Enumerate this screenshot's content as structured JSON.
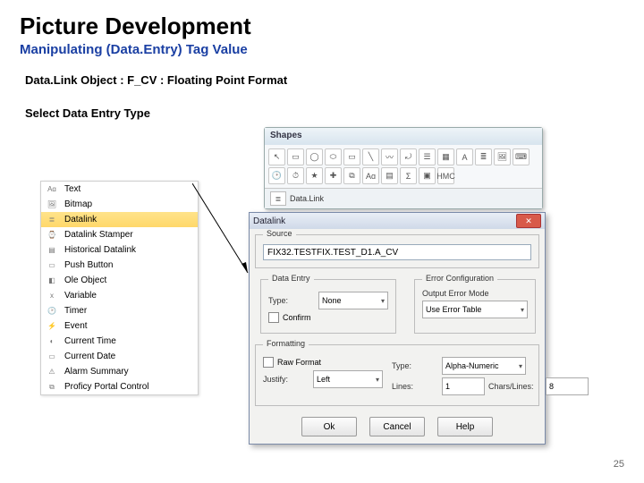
{
  "title": "Picture Development",
  "subtitle": "Manipulating (Data.Entry) Tag Value",
  "line_object": "Data.Link Object : F_CV : Floating Point Format",
  "line_select": "Select Data Entry Type",
  "pagenum": "25",
  "toolbox": {
    "header": "Shapes",
    "footer_label": "Data.Link",
    "tools": [
      "↖",
      "▭",
      "◯",
      "⬭",
      "▭",
      "╲",
      "〰",
      "⤾",
      "☰",
      "▦",
      "A",
      "≣",
      "🖼",
      "⌨",
      "🕑",
      "⏱",
      "★",
      "✚",
      "⧉",
      "Aɑ",
      "▤",
      "Σ",
      "▣",
      "HMC"
    ]
  },
  "menu": {
    "items": [
      {
        "icon": "Aɑ",
        "label": "Text"
      },
      {
        "icon": "🖼",
        "label": "Bitmap"
      },
      {
        "icon": "≣",
        "label": "Datalink",
        "selected": true
      },
      {
        "icon": "⌚",
        "label": "Datalink Stamper"
      },
      {
        "icon": "▤",
        "label": "Historical Datalink"
      },
      {
        "icon": "▭",
        "label": "Push Button"
      },
      {
        "icon": "◧",
        "label": "Ole Object"
      },
      {
        "icon": "x",
        "label": "Variable"
      },
      {
        "icon": "🕑",
        "label": "Timer"
      },
      {
        "icon": "⚡",
        "label": "Event"
      },
      {
        "icon": "◐",
        "label": "Current Time"
      },
      {
        "icon": "▭",
        "label": "Current Date"
      },
      {
        "icon": "⚠",
        "label": "Alarm Summary"
      },
      {
        "icon": "⧉",
        "label": "Proficy Portal Control"
      }
    ]
  },
  "dialog": {
    "title": "Datalink",
    "close": "✕",
    "source_group": "Source",
    "source_value": "FIX32.TESTFIX.TEST_D1.A_CV",
    "dataentry_group": "Data Entry",
    "type_label": "Type:",
    "type_value": "None",
    "confirm_label": "Confirm",
    "errconf_group": "Error Configuration",
    "outerr_label": "Output Error Mode",
    "outerr_value": "Use Error Table",
    "formatting_group": "Formatting",
    "raw_label": "Raw Format",
    "justify_label": "Justify:",
    "justify_value": "Left",
    "typefmt_label": "Type:",
    "typefmt_value": "Alpha-Numeric",
    "lines_label": "Lines:",
    "lines_value": "1",
    "chars_label": "Chars/Lines:",
    "chars_value": "8",
    "ok": "Ok",
    "cancel": "Cancel",
    "help": "Help"
  }
}
